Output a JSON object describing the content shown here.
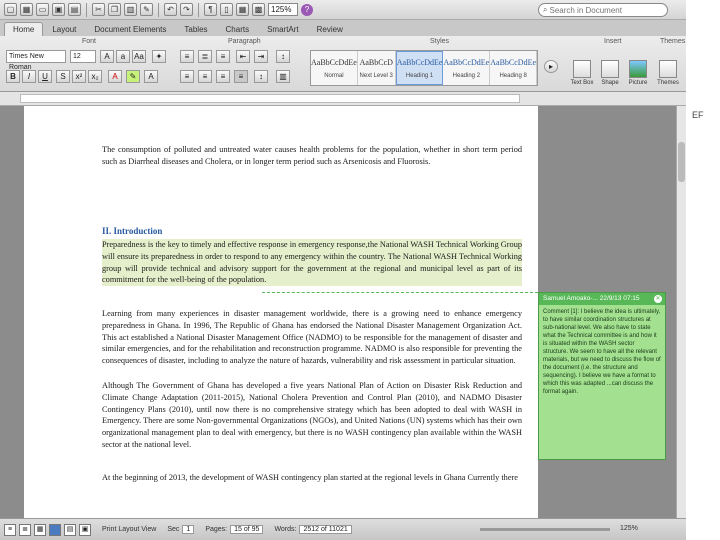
{
  "toolbar": {
    "zoom": "125%",
    "search_placeholder": "Search in Document"
  },
  "ribbon": {
    "tabs": [
      "Home",
      "Layout",
      "Document Elements",
      "Tables",
      "Charts",
      "SmartArt",
      "Review"
    ],
    "groups": {
      "font": "Font",
      "paragraph": "Paragraph",
      "styles": "Styles",
      "insert": "Insert",
      "themes": "Themes"
    },
    "font_name": "Times New Roman",
    "font_size": "12",
    "styles": [
      {
        "sample": "AaBbCcDdEe",
        "name": "Normal"
      },
      {
        "sample": "AaBbCcD",
        "name": "Next Level 3"
      },
      {
        "sample": "AaBbCcDdEe",
        "name": "Heading 1"
      },
      {
        "sample": "AaBbCcDdEe",
        "name": "Heading 2"
      },
      {
        "sample": "AaBbCcDdEe",
        "name": "Heading 8"
      }
    ],
    "insert": [
      "Text Box",
      "Shape",
      "Picture",
      "Themes"
    ]
  },
  "document": {
    "para1": "The consumption of polluted and untreated water causes health problems for the population, whether in short term period such as Diarrheal diseases and Cholera, or in longer term period such as Arsenicosis and Fluorosis.",
    "heading": "II. Introduction",
    "para2": "Preparedness is the key to timely and effective response in emergency response,the National WASH Technical Working Group will ensure its preparedness in order to respond to any emergency within the country. The National WASH Technical Working group will provide technical and advisory support for the government at the regional and municipal level as part of its commitment for the well-being of the population.",
    "para3": "Learning from many experiences in disaster management worldwide, there is a growing need to enhance emergency preparedness in Ghana. In 1996, The Republic of Ghana has endorsed the National Disaster Management Organization Act. This act established a National Disaster Management Office (NADMO) to be responsible for the management of disaster and similar emergencies, and for the rehabilitation and reconstruction programme. NADMO is also responsible for preventing the consequences of disaster, including to analyze the nature of hazards, vulnerability and risk assessment in particular situation.",
    "para4": "Although The Government of Ghana has developed a five years National Plan of Action on Disaster Risk Reduction and Climate Change Adaptation (2011-2015), National Cholera Prevention and Control Plan (2010), and NADMO Disaster Contingency Plans (2010), until now there is no comprehensive strategy which has been adopted to deal with WASH in Emergency. There are some Non-governmental Organizations (NGOs), and United Nations (UN) systems which has their own organizational management plan to deal with emergency, but there is no WASH contingency plan available within the WASH sector at the national level.",
    "para5": "At the beginning of 2013, the development of WASH contingency plan started at the regional levels in Ghana Currently there"
  },
  "comment": {
    "author": "Samuel Amoako-... 22/9/13 07:15",
    "body": "Comment [1]: I believe the idea is ultimately, to have similar coordination structures at sub-national level. We also have to state what the Technical committee is and how it is situated within the WASH sector structure. We seem to have all the relevant materials, but we need to discuss the flow of the document (i.e. the structure and sequencing). I believe we have a format to which this was adapted ...can discuss the format again."
  },
  "status": {
    "view": "Print Layout View",
    "sec_label": "Sec",
    "sec": "1",
    "pages_label": "Pages:",
    "pages": "15 of 95",
    "words_label": "Words:",
    "words": "2512 of 11021",
    "zoom": "125%"
  },
  "right_strip_text": "EF"
}
